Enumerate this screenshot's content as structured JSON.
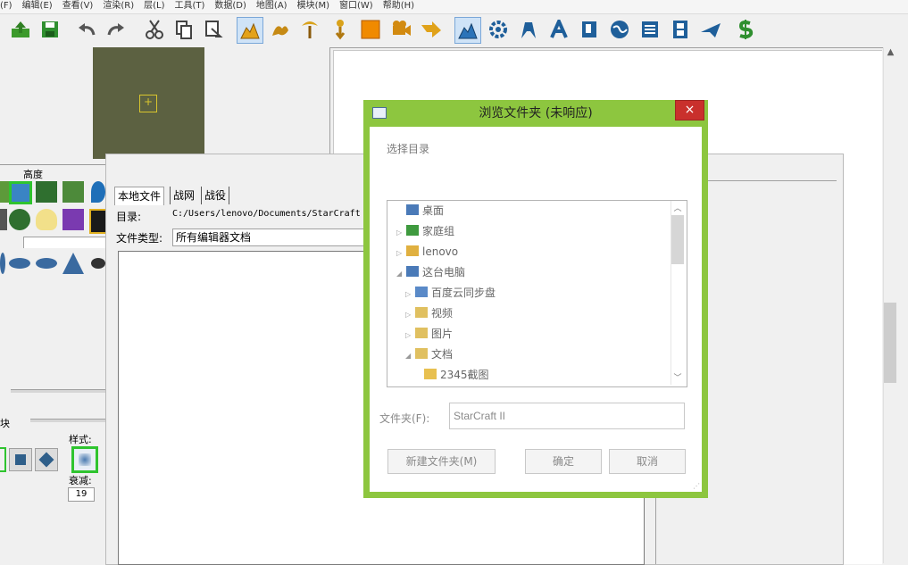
{
  "menubar": {
    "items": [
      "(F)",
      "编辑(E)",
      "查看(V)",
      "渲染(R)",
      "层(L)",
      "工具(T)",
      "数据(D)",
      "地图(A)",
      "模块(M)",
      "窗口(W)",
      "帮助(H)"
    ]
  },
  "toolbar": {
    "buttons": [
      "export-icon",
      "save-icon",
      "undo-icon",
      "redo-icon",
      "cut-icon",
      "copy-icon",
      "paste-icon",
      "terrain-icon",
      "creature-icon",
      "doodad-icon",
      "point-icon",
      "region-icon",
      "camera-icon",
      "path-icon",
      "terrain-mode-icon",
      "gear-icon",
      "unit-icon",
      "text-icon",
      "document-icon",
      "globe-icon",
      "list-icon",
      "film-icon",
      "plane-icon",
      "dollar-icon"
    ]
  },
  "left_panel": {
    "height_label": "高度",
    "block_label": "块",
    "style_label": "样式:",
    "falloff_label": "衰减:",
    "falloff_value": "19"
  },
  "file_dialog": {
    "tabs": [
      "本地文件",
      "战网",
      "战役"
    ],
    "dir_label": "目录:",
    "dir_value": "C:/Users/lenovo/Documents/StarCraft",
    "type_label": "文件类型:",
    "type_value": "所有编辑器文档"
  },
  "browse_dialog": {
    "title": "浏览文件夹 (未响应)",
    "close": "×",
    "choose_label": "选择目录",
    "tree": [
      {
        "label": "桌面",
        "indent": 0,
        "expander": "",
        "icon": "desktop-icon"
      },
      {
        "label": "家庭组",
        "indent": 0,
        "expander": "▷",
        "icon": "homegroup-icon"
      },
      {
        "label": "lenovo",
        "indent": 0,
        "expander": "▷",
        "icon": "user-folder-icon"
      },
      {
        "label": "这台电脑",
        "indent": 0,
        "expander": "◢",
        "icon": "computer-icon"
      },
      {
        "label": "百度云同步盘",
        "indent": 1,
        "expander": "▷",
        "icon": "cloud-icon"
      },
      {
        "label": "视频",
        "indent": 1,
        "expander": "▷",
        "icon": "video-folder-icon"
      },
      {
        "label": "图片",
        "indent": 1,
        "expander": "▷",
        "icon": "picture-folder-icon"
      },
      {
        "label": "文档",
        "indent": 1,
        "expander": "◢",
        "icon": "document-folder-icon"
      },
      {
        "label": "2345截图",
        "indent": 2,
        "expander": "",
        "icon": "folder-icon"
      }
    ],
    "folder_label": "文件夹(F):",
    "folder_value": "StarCraft II",
    "new_folder": "新建文件夹(M)",
    "ok": "确定",
    "cancel": "取消"
  },
  "colors": {
    "browse_frame": "#8dc63f",
    "close_button": "#c9302c",
    "preview_bg": "#5c6141"
  }
}
